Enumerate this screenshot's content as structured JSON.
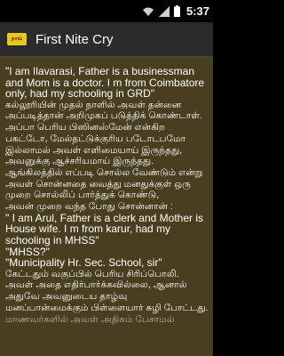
{
  "status_bar": {
    "time": "5:37",
    "icons": [
      "wifi-icon",
      "signal-icon",
      "battery-icon"
    ]
  },
  "app_bar": {
    "icon_label": "நாவ்",
    "title": "First Nite Cry"
  },
  "colors": {
    "content_bg": "#493e20",
    "title_bg": "#2b2b2b",
    "status_bg": "#000000"
  },
  "story": {
    "lines": [
      {
        "lang": "en",
        "text": "\"I am Ilavarasi, Father is a businessman and Mom is a doctor. I m from Coimbatore only, had my schooling in GRD\""
      },
      {
        "lang": "ta",
        "text": "கல்லூரியின் முதல் நாளில் அவள் தன்னை அப்படித்தான் அறிமுகப் படுத்திக் கொண்டாள்."
      },
      {
        "lang": "ta",
        "text": "அப்பா பெரிய பிஸினஸ்மேன் என்கிற பகட்டோ, மேல்தட்டுக்குரிய படோடபமோ இல்லாமல் அவள் எளிமையாய் இருந்தது, அவனுக்கு ஆச்சரியமாய் இருந்தது."
      },
      {
        "lang": "ta",
        "text": "ஆங்கிலத்தில் எப்படி சொல்ல வேண்டும் என்று அவள் சொன்னதை வைத்து மனதுக்குள் ஒரு முறை சொல்லிப் பார்த்துக் கொண்டு,"
      },
      {
        "lang": "ta",
        "text": "அவன் முறை வந்த போது சொன்னான் :"
      },
      {
        "lang": "en",
        "text": "\" I am Arul, Father is a clerk and Mother is House wife. I m from karur, had my schooling in MHSS\""
      },
      {
        "lang": "en",
        "text": "\"MHSS?\""
      },
      {
        "lang": "en",
        "text": "\"Municipality Hr. Sec. School, sir\""
      },
      {
        "lang": "ta",
        "text": "கேட்டதும் வகுப்பில் பெரிய சிரிப்பொலி. அவள் அதை எதிர்பார்க்கவில்லை, ஆனால் அதுவே அவனுடைய தாழ்வு மனப்பான்மைக்கும் பிள்ளையார் சுழி போட்டது."
      }
    ],
    "partial_line": "மாணவர்களில் அவள் அதிகம் பேசாமல்"
  }
}
